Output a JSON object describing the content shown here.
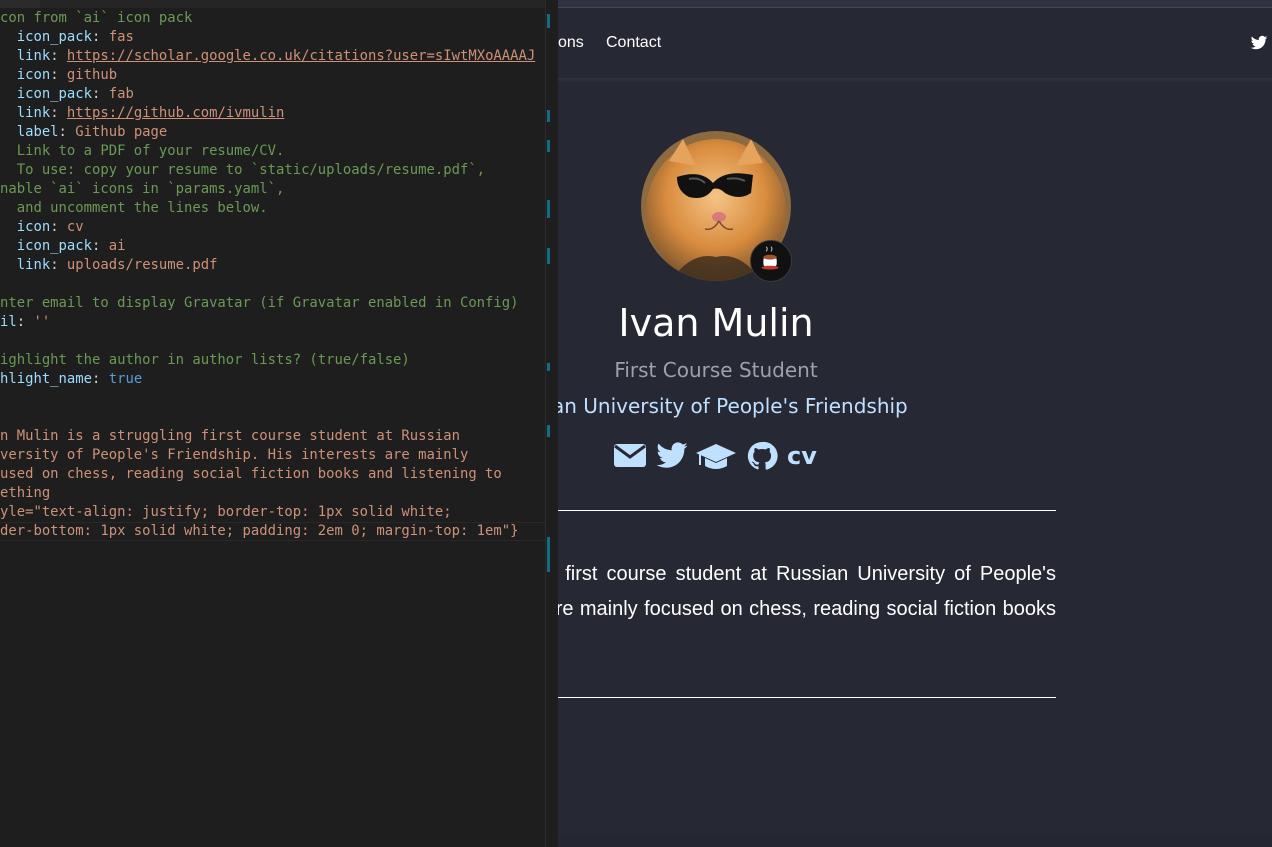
{
  "editor": {
    "code_lines": [
      [
        [
          "c",
          "con from `ai` icon pack"
        ]
      ],
      [
        [
          "k",
          "  icon_pack"
        ],
        [
          "p",
          ": "
        ],
        [
          "s",
          "fas"
        ]
      ],
      [
        [
          "k",
          "  link"
        ],
        [
          "p",
          ": "
        ],
        [
          "su",
          "https://scholar.google.co.uk/citations?user=sIwtMXoAAAAJ"
        ]
      ],
      [
        [
          "k",
          "  icon"
        ],
        [
          "p",
          ": "
        ],
        [
          "s",
          "github"
        ]
      ],
      [
        [
          "k",
          "  icon_pack"
        ],
        [
          "p",
          ": "
        ],
        [
          "s",
          "fab"
        ]
      ],
      [
        [
          "k",
          "  link"
        ],
        [
          "p",
          ": "
        ],
        [
          "su",
          "https://github.com/ivmulin"
        ]
      ],
      [
        [
          "k",
          "  label"
        ],
        [
          "p",
          ": "
        ],
        [
          "s",
          "Github page"
        ]
      ],
      [
        [
          "c",
          "  Link to a PDF of your resume/CV."
        ]
      ],
      [
        [
          "c",
          "  To use: copy your resume to `static/uploads/resume.pdf`,"
        ]
      ],
      [
        [
          "c",
          "nable `ai` icons in `params.yaml`,"
        ]
      ],
      [
        [
          "c",
          "  and uncomment the lines below."
        ]
      ],
      [
        [
          "k",
          "  icon"
        ],
        [
          "p",
          ": "
        ],
        [
          "s",
          "cv"
        ]
      ],
      [
        [
          "k",
          "  icon_pack"
        ],
        [
          "p",
          ": "
        ],
        [
          "s",
          "ai"
        ]
      ],
      [
        [
          "k",
          "  link"
        ],
        [
          "p",
          ": "
        ],
        [
          "s",
          "uploads/resume.pdf"
        ]
      ],
      [
        [
          "p",
          ""
        ]
      ],
      [
        [
          "c",
          "nter email to display Gravatar (if Gravatar enabled in Config)"
        ]
      ],
      [
        [
          "k",
          "il"
        ],
        [
          "p",
          ": "
        ],
        [
          "s",
          "''"
        ]
      ],
      [
        [
          "p",
          ""
        ]
      ],
      [
        [
          "c",
          "ighlight the author in author lists? (true/false)"
        ]
      ],
      [
        [
          "k",
          "hlight_name"
        ],
        [
          "p",
          ": "
        ],
        [
          "b",
          "true"
        ]
      ],
      [
        [
          "p",
          ""
        ]
      ],
      [
        [
          "p",
          ""
        ]
      ],
      [
        [
          "s",
          "n Mulin is a struggling first course student at Russian"
        ]
      ],
      [
        [
          "s",
          "versity of People's Friendship. His interests are mainly"
        ]
      ],
      [
        [
          "s",
          "used on chess, reading social fiction books and listening to"
        ]
      ],
      [
        [
          "s",
          "ething"
        ]
      ],
      [
        [
          "s",
          "yle=\"text-align: justify; border-top: 1px solid white;"
        ]
      ],
      [
        [
          "s",
          "der-bottom: 1px solid white; padding: 2em 0; margin-top: 1em\"}"
        ]
      ]
    ]
  },
  "site": {
    "nav": {
      "publications_label": "ons",
      "contact_label": "Contact",
      "twitter_icon": "twitter-icon"
    },
    "profile": {
      "name": "Ivan Mulin",
      "role": "First Course Student",
      "organization": "an University of People's Friendship",
      "avatar": "cat-with-sunglasses",
      "badge": "coffee-cup-icon"
    },
    "social": {
      "email_icon": "envelope-icon",
      "twitter_icon": "twitter-icon",
      "scholar_icon": "graduation-cap-icon",
      "github_icon": "github-icon",
      "cv_label": "cv"
    },
    "bio": {
      "text": "Ivan Mulin is a struggling first course student at Russian University of People's Friendship. His interests are mainly focused on chess, reading social fiction books and listening to something"
    },
    "colors": {
      "site_background": "#262834",
      "accent": "#bfe0ff",
      "editor_background": "#1e1e1e"
    }
  }
}
